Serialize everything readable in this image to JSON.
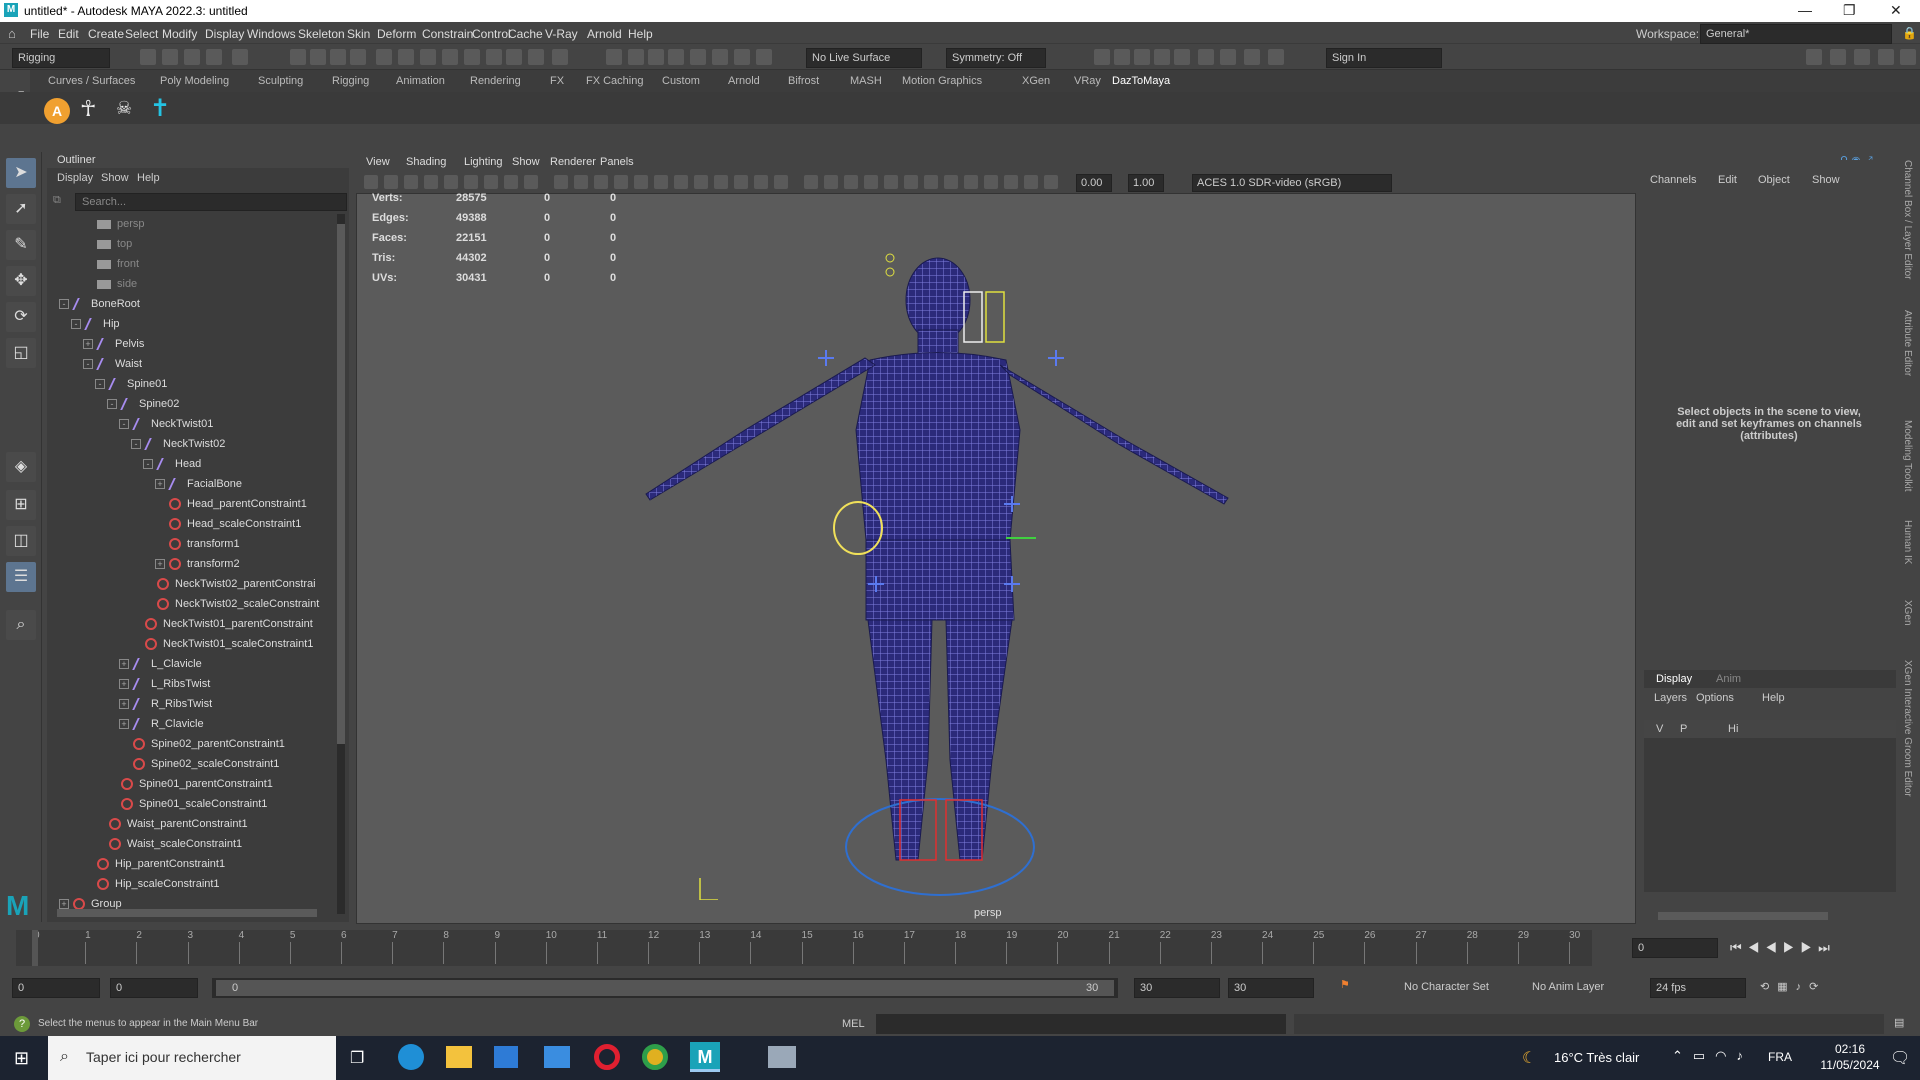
{
  "window": {
    "title": "untitled* - Autodesk MAYA 2022.3: untitled",
    "logo": "M"
  },
  "menu": [
    "File",
    "Edit",
    "Create",
    "Select",
    "Modify",
    "Display",
    "Windows",
    "Skeleton",
    "Skin",
    "Deform",
    "Constrain",
    "Control",
    "Cache",
    "V-Ray",
    "Arnold",
    "Help"
  ],
  "workspace": {
    "label": "Workspace:",
    "value": "General*"
  },
  "status": {
    "menuset": "Rigging",
    "live_surface": "No Live Surface",
    "symmetry": "Symmetry: Off",
    "signin": "Sign In"
  },
  "shelf_tabs": [
    "Curves / Surfaces",
    "Poly Modeling",
    "Sculpting",
    "Rigging",
    "Animation",
    "Rendering",
    "FX",
    "FX Caching",
    "Custom",
    "Arnold",
    "Bifrost",
    "MASH",
    "Motion Graphics",
    "XGen",
    "VRay",
    "DazToMaya"
  ],
  "shelf_active": "DazToMaya",
  "outliner": {
    "title": "Outliner",
    "menu": [
      "Display",
      "Show",
      "Help"
    ],
    "search_placeholder": "Search...",
    "items": [
      {
        "label": "persp",
        "type": "cam",
        "indent": 0,
        "exp": ""
      },
      {
        "label": "top",
        "type": "cam",
        "indent": 0,
        "exp": ""
      },
      {
        "label": "front",
        "type": "cam",
        "indent": 0,
        "exp": ""
      },
      {
        "label": "side",
        "type": "cam",
        "indent": 0,
        "exp": ""
      },
      {
        "label": "BoneRoot",
        "type": "jnt",
        "indent": 0,
        "exp": "-"
      },
      {
        "label": "Hip",
        "type": "jnt",
        "indent": 1,
        "exp": "-"
      },
      {
        "label": "Pelvis",
        "type": "jnt",
        "indent": 2,
        "exp": "+"
      },
      {
        "label": "Waist",
        "type": "jnt",
        "indent": 2,
        "exp": "-"
      },
      {
        "label": "Spine01",
        "type": "jnt",
        "indent": 3,
        "exp": "-"
      },
      {
        "label": "Spine02",
        "type": "jnt",
        "indent": 4,
        "exp": "-"
      },
      {
        "label": "NeckTwist01",
        "type": "jnt",
        "indent": 5,
        "exp": "-"
      },
      {
        "label": "NeckTwist02",
        "type": "jnt",
        "indent": 6,
        "exp": "-"
      },
      {
        "label": "Head",
        "type": "jnt",
        "indent": 7,
        "exp": "-"
      },
      {
        "label": "FacialBone",
        "type": "jnt",
        "indent": 8,
        "exp": "+"
      },
      {
        "label": "Head_parentConstraint1",
        "type": "cns",
        "indent": 8,
        "exp": ""
      },
      {
        "label": "Head_scaleConstraint1",
        "type": "cns",
        "indent": 8,
        "exp": ""
      },
      {
        "label": "transform1",
        "type": "cns",
        "indent": 8,
        "exp": ""
      },
      {
        "label": "transform2",
        "type": "cns",
        "indent": 8,
        "exp": "+"
      },
      {
        "label": "NeckTwist02_parentConstrai",
        "type": "cns",
        "indent": 7,
        "exp": ""
      },
      {
        "label": "NeckTwist02_scaleConstraint",
        "type": "cns",
        "indent": 7,
        "exp": ""
      },
      {
        "label": "NeckTwist01_parentConstraint",
        "type": "cns",
        "indent": 6,
        "exp": ""
      },
      {
        "label": "NeckTwist01_scaleConstraint1",
        "type": "cns",
        "indent": 6,
        "exp": ""
      },
      {
        "label": "L_Clavicle",
        "type": "jnt",
        "indent": 5,
        "exp": "+"
      },
      {
        "label": "L_RibsTwist",
        "type": "jnt",
        "indent": 5,
        "exp": "+"
      },
      {
        "label": "R_RibsTwist",
        "type": "jnt",
        "indent": 5,
        "exp": "+"
      },
      {
        "label": "R_Clavicle",
        "type": "jnt",
        "indent": 5,
        "exp": "+"
      },
      {
        "label": "Spine02_parentConstraint1",
        "type": "cns",
        "indent": 5,
        "exp": ""
      },
      {
        "label": "Spine02_scaleConstraint1",
        "type": "cns",
        "indent": 5,
        "exp": ""
      },
      {
        "label": "Spine01_parentConstraint1",
        "type": "cns",
        "indent": 4,
        "exp": ""
      },
      {
        "label": "Spine01_scaleConstraint1",
        "type": "cns",
        "indent": 4,
        "exp": ""
      },
      {
        "label": "Waist_parentConstraint1",
        "type": "cns",
        "indent": 3,
        "exp": ""
      },
      {
        "label": "Waist_scaleConstraint1",
        "type": "cns",
        "indent": 3,
        "exp": ""
      },
      {
        "label": "Hip_parentConstraint1",
        "type": "cns",
        "indent": 2,
        "exp": ""
      },
      {
        "label": "Hip_scaleConstraint1",
        "type": "cns",
        "indent": 2,
        "exp": ""
      },
      {
        "label": "Group",
        "type": "cns",
        "indent": 0,
        "exp": "+"
      }
    ]
  },
  "viewport": {
    "menu": [
      "View",
      "Shading",
      "Lighting",
      "Show",
      "Renderer",
      "Panels"
    ],
    "field1": "0.00",
    "field2": "1.00",
    "colorspace": "ACES 1.0 SDR-video (sRGB)",
    "camera": "persp",
    "stats": [
      {
        "label": "Verts:",
        "a": "28575",
        "b": "0",
        "c": "0"
      },
      {
        "label": "Edges:",
        "a": "49388",
        "b": "0",
        "c": "0"
      },
      {
        "label": "Faces:",
        "a": "22151",
        "b": "0",
        "c": "0"
      },
      {
        "label": "Tris:",
        "a": "44302",
        "b": "0",
        "c": "0"
      },
      {
        "label": "UVs:",
        "a": "30431",
        "b": "0",
        "c": "0"
      }
    ]
  },
  "channelbox": {
    "menu": [
      "Channels",
      "Edit",
      "Object",
      "Show"
    ],
    "message": "Select objects in the scene to view, edit and set keyframes on channels (attributes)",
    "tabs": [
      "Display",
      "Anim"
    ],
    "layer_menu": [
      "Layers",
      "Options",
      "Help"
    ],
    "layer": {
      "v": "V",
      "p": "P",
      "name": "Hi"
    }
  },
  "side_tabs": [
    "Channel Box / Layer Editor",
    "Attribute Editor",
    "Modeling Toolkit",
    "Human IK",
    "XGen",
    "XGen Interactive Groom Editor"
  ],
  "timeline": {
    "ticks": [
      "0",
      "1",
      "2",
      "3",
      "4",
      "5",
      "6",
      "7",
      "8",
      "9",
      "10",
      "11",
      "12",
      "13",
      "14",
      "15",
      "16",
      "17",
      "18",
      "19",
      "20",
      "21",
      "22",
      "23",
      "24",
      "25",
      "26",
      "27",
      "28",
      "29",
      "30"
    ],
    "current": "0"
  },
  "range": {
    "start": "0",
    "start2": "0",
    "slider_left": "0",
    "slider_right": "30",
    "end": "30",
    "end2": "30",
    "character": "No Character Set",
    "anim_layer": "No Anim Layer",
    "fps": "24 fps"
  },
  "cmd": {
    "help": "Select the menus to appear in the Main Menu Bar",
    "lang": "MEL"
  },
  "taskbar": {
    "search": "Taper ici pour rechercher",
    "weather": "16°C  Très clair",
    "lang": "FRA",
    "time": "02:16",
    "date": "11/05/2024"
  }
}
